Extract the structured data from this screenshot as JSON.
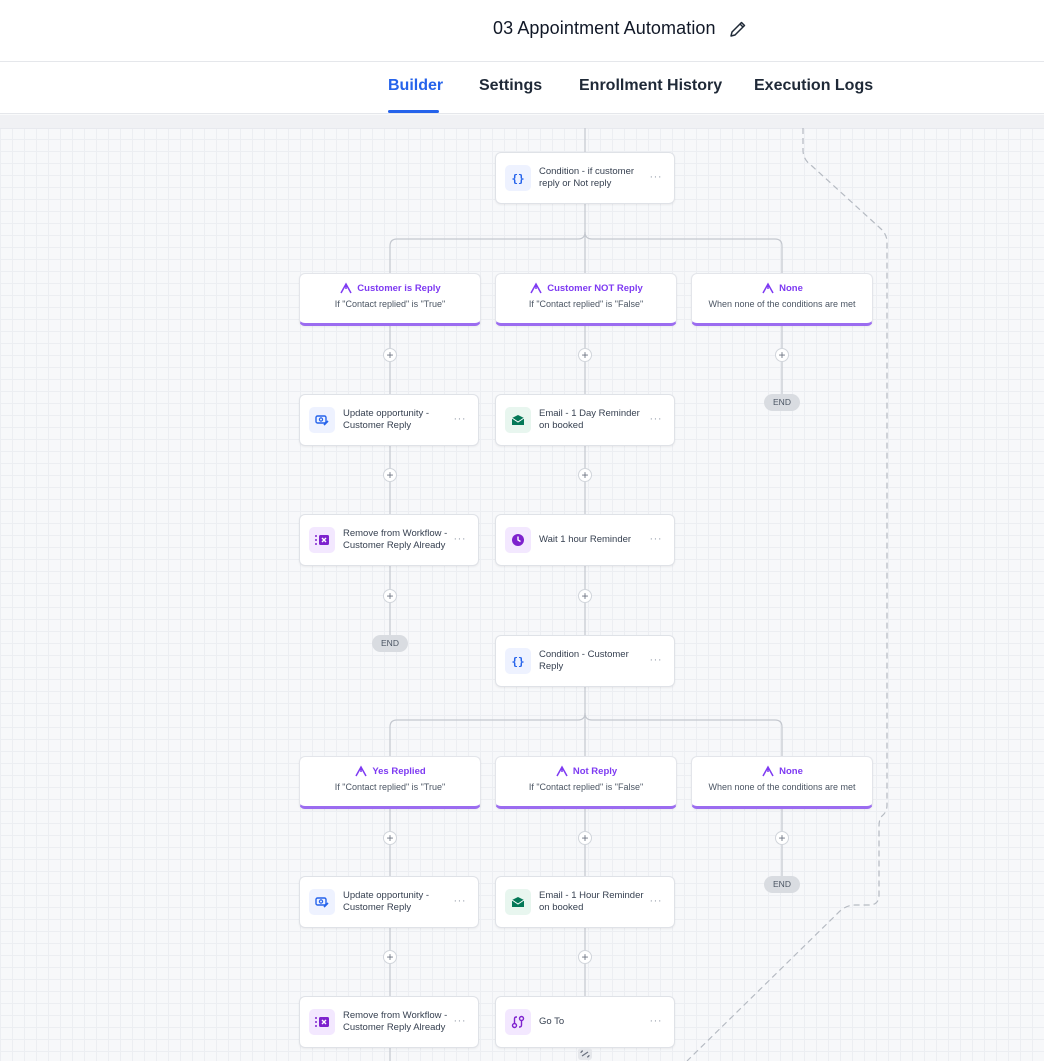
{
  "header": {
    "title": "03 Appointment Automation"
  },
  "tabs": [
    {
      "label": "Builder",
      "active": true
    },
    {
      "label": "Settings",
      "active": false
    },
    {
      "label": "Enrollment History",
      "active": false
    },
    {
      "label": "Execution Logs",
      "active": false
    }
  ],
  "colors": {
    "accent": "#2563eb",
    "branch_accent": "#9b6cf0",
    "email": "#047857",
    "wait": "#7e22ce"
  },
  "nodes": {
    "condition1": {
      "label": "Condition - if customer reply or Not reply",
      "icon": "braces-icon"
    },
    "update1": {
      "label": "Update opportunity - Customer Reply",
      "icon": "update-opportunity-icon"
    },
    "email1": {
      "label": "Email - 1 Day Reminder on booked",
      "icon": "email-icon"
    },
    "remove1": {
      "label": "Remove from Workflow - Customer Reply Already",
      "icon": "remove-workflow-icon"
    },
    "wait1": {
      "label": "Wait 1 hour Reminder",
      "icon": "clock-icon"
    },
    "condition2": {
      "label": "Condition - Customer Reply",
      "icon": "braces-icon"
    },
    "update2": {
      "label": "Update opportunity - Customer Reply",
      "icon": "update-opportunity-icon"
    },
    "email2": {
      "label": "Email - 1 Hour Reminder on booked",
      "icon": "email-icon"
    },
    "remove2": {
      "label": "Remove from Workflow - Customer Reply Already",
      "icon": "remove-workflow-icon"
    },
    "goto": {
      "label": "Go To",
      "icon": "goto-icon"
    }
  },
  "branches": {
    "b1": {
      "title": "Customer is Reply",
      "subtitle": "If \"Contact replied\" is \"True\""
    },
    "b2": {
      "title": "Customer NOT Reply",
      "subtitle": "If \"Contact replied\" is \"False\""
    },
    "b3": {
      "title": "None",
      "subtitle": "When none of the conditions are met"
    },
    "b4": {
      "title": "Yes Replied",
      "subtitle": "If \"Contact replied\" is \"True\""
    },
    "b5": {
      "title": "Not Reply",
      "subtitle": "If \"Contact replied\" is \"False\""
    },
    "b6": {
      "title": "None",
      "subtitle": "When none of the conditions are met"
    }
  },
  "end_label": "END",
  "more_label": "···",
  "plus_label": "+"
}
